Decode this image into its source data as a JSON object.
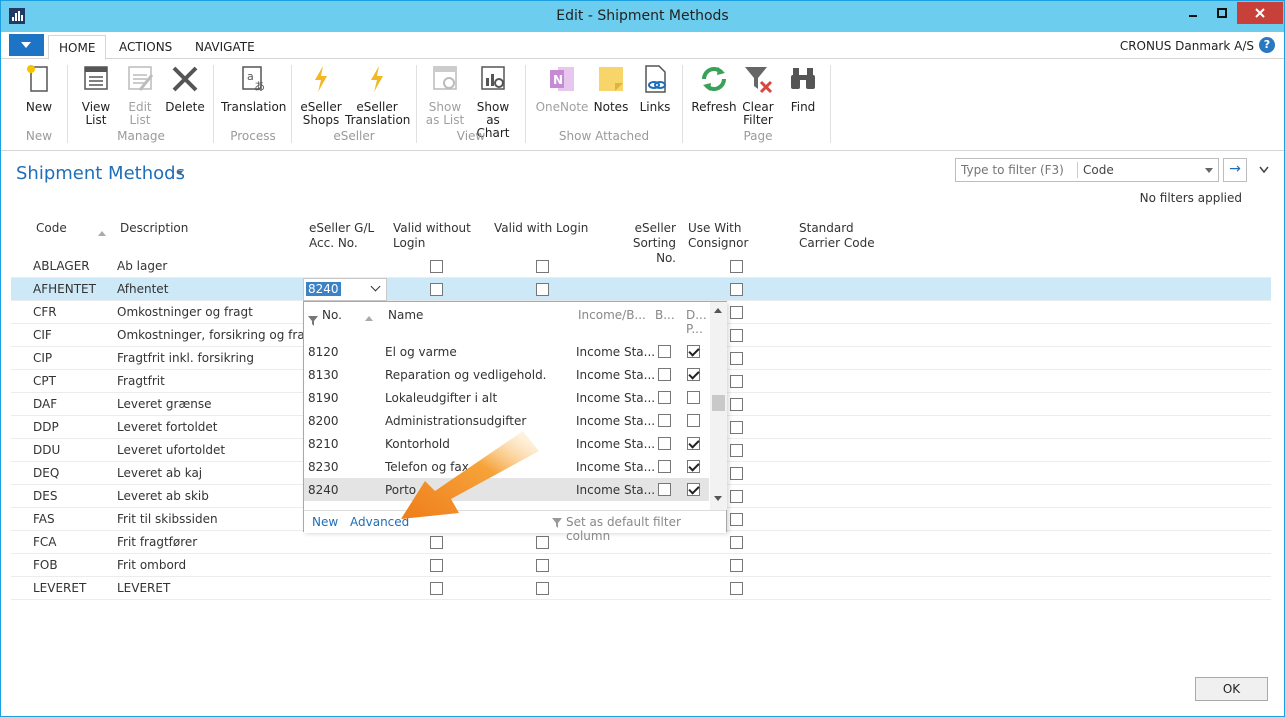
{
  "window": {
    "title": "Edit - Shipment Methods"
  },
  "tabs": {
    "home": "HOME",
    "actions": "ACTIONS",
    "navigate": "NAVIGATE"
  },
  "company": "CRONUS Danmark A/S",
  "help": "?",
  "ribbon": {
    "new": [
      "New"
    ],
    "view_list": [
      "View",
      "List"
    ],
    "edit_list": [
      "Edit",
      "List"
    ],
    "delete": [
      "Delete"
    ],
    "translation": [
      "Translation"
    ],
    "eseller_shops": [
      "eSeller",
      "Shops"
    ],
    "eseller_translation": [
      "eSeller",
      "Translation"
    ],
    "show_as_list": [
      "Show",
      "as List"
    ],
    "show_as_chart": [
      "Show as",
      "Chart"
    ],
    "onenote": [
      "OneNote"
    ],
    "notes": [
      "Notes"
    ],
    "links": [
      "Links"
    ],
    "refresh": [
      "Refresh"
    ],
    "clear_filter": [
      "Clear",
      "Filter"
    ],
    "find": [
      "Find"
    ],
    "groups": {
      "new": "New",
      "manage": "Manage",
      "process": "Process",
      "eseller": "eSeller",
      "view": "View",
      "show_attached": "Show Attached",
      "page": "Page"
    }
  },
  "page": {
    "title": "Shipment Methods"
  },
  "filter": {
    "placeholder": "Type to filter (F3)",
    "field": "Code",
    "status": "No filters applied",
    "go": "→"
  },
  "columns": {
    "code": "Code",
    "description": "Description",
    "gl_acc": [
      "eSeller G/L",
      "Acc. No."
    ],
    "valid_without": [
      "Valid without",
      "Login"
    ],
    "valid_with": "Valid with Login",
    "sorting": [
      "eSeller",
      "Sorting No."
    ],
    "consignor": [
      "Use With",
      "Consignor"
    ],
    "carrier": [
      "Standard",
      "Carrier Code"
    ]
  },
  "rows": [
    {
      "code": "ABLAGER",
      "description": "Ab lager"
    },
    {
      "code": "AFHENTET",
      "description": "Afhentet"
    },
    {
      "code": "CFR",
      "description": "Omkostninger og fragt"
    },
    {
      "code": "CIF",
      "description": "Omkostninger, forsikring og fragt"
    },
    {
      "code": "CIP",
      "description": "Fragtfrit inkl. forsikring"
    },
    {
      "code": "CPT",
      "description": "Fragtfrit"
    },
    {
      "code": "DAF",
      "description": "Leveret grænse"
    },
    {
      "code": "DDP",
      "description": "Leveret fortoldet"
    },
    {
      "code": "DDU",
      "description": "Leveret ufortoldet"
    },
    {
      "code": "DEQ",
      "description": "Leveret ab kaj"
    },
    {
      "code": "DES",
      "description": "Leveret ab skib"
    },
    {
      "code": "FAS",
      "description": "Frit til skibssiden"
    },
    {
      "code": "FCA",
      "description": "Frit fragtfører"
    },
    {
      "code": "FOB",
      "description": "Frit ombord"
    },
    {
      "code": "LEVERET",
      "description": "LEVERET"
    }
  ],
  "edit_value": "8240",
  "lookup": {
    "headers": {
      "no": "No.",
      "name": "Name",
      "income": "Income/B...",
      "b": "B...",
      "d1": "D...",
      "d2": "P..."
    },
    "rows": [
      {
        "no": "8120",
        "name": "El og varme",
        "income": "Income Sta...",
        "b": false,
        "d": true
      },
      {
        "no": "8130",
        "name": "Reparation og vedligehold.",
        "income": "Income Sta...",
        "b": false,
        "d": true
      },
      {
        "no": "8190",
        "name": "Lokaleudgifter i alt",
        "income": "Income Sta...",
        "b": false,
        "d": false
      },
      {
        "no": "8200",
        "name": "Administrationsudgifter",
        "income": "Income Sta...",
        "b": false,
        "d": false
      },
      {
        "no": "8210",
        "name": "Kontorhold",
        "income": "Income Sta...",
        "b": false,
        "d": true
      },
      {
        "no": "8230",
        "name": "Telefon og fax",
        "income": "Income Sta...",
        "b": false,
        "d": true
      },
      {
        "no": "8240",
        "name": "Porto",
        "income": "Income Sta...",
        "b": false,
        "d": true
      }
    ],
    "footer": {
      "new": "New",
      "advanced": "Advanced",
      "set_default": "Set as default filter column"
    }
  },
  "ok": "OK",
  "colors": {
    "accent": "#1e6fb8",
    "titlebar": "#6ccdef",
    "selected_row": "#cde8f6",
    "arrow": "#f28a1e"
  }
}
